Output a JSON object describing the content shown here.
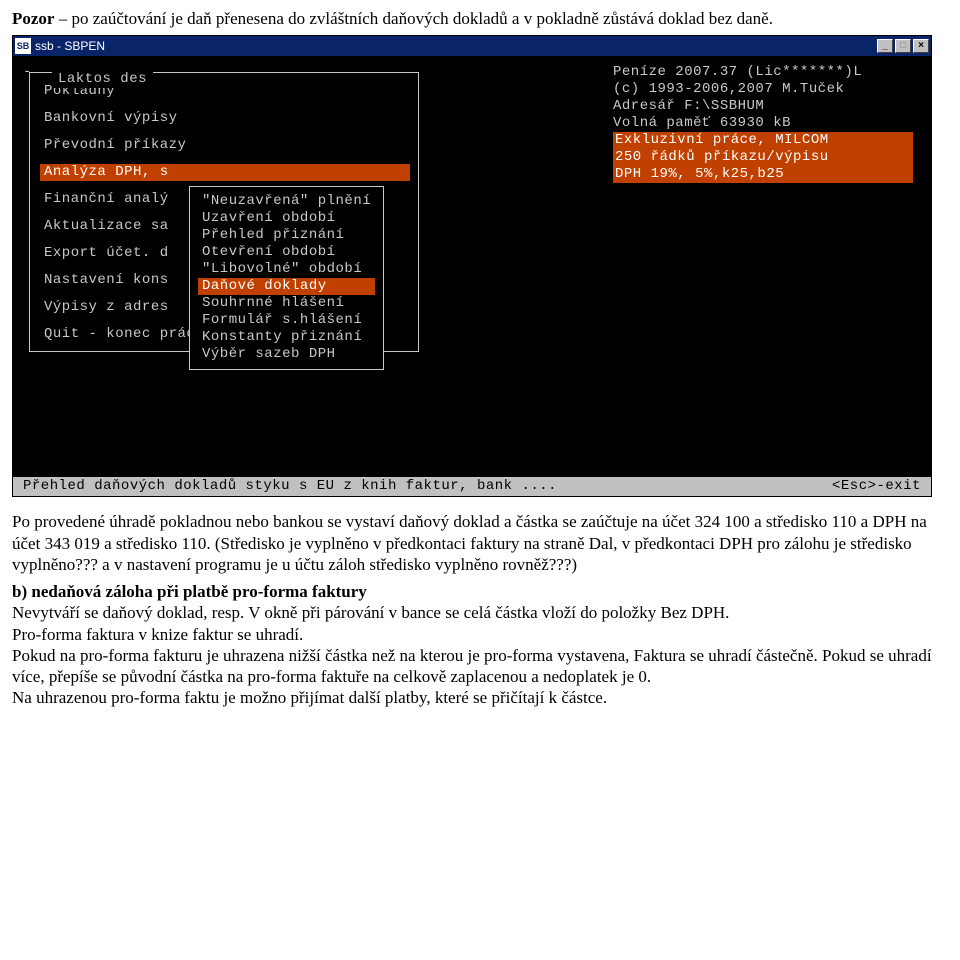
{
  "doc": {
    "top_note_label": "Pozor",
    "top_note_rest": " – po zaúčtování je daň přenesena do zvláštních daňových dokladů a v pokladně zůstává doklad bez daně.",
    "p2": "Po provedené úhradě pokladnou nebo bankou se vystaví daňový doklad a částka se zaúčtuje na účet  324 100 a středisko 110 a DPH na účet 343 019 a středisko 110. (Středisko je vyplněno v předkontaci faktury na straně Dal,  v předkontaci DPH pro zálohu je středisko vyplněno??? a v nastavení programu je u účtu záloh středisko vyplněno rovněž???)",
    "b_heading": "b) nedaňová záloha při platbě pro-forma faktury",
    "p3": "Nevytváří se daňový doklad, resp. V okně při párování v bance se celá částka vloží do položky Bez DPH.",
    "p4": "Pro-forma faktura v knize faktur se uhradí.",
    "p5": "Pokud na pro-forma fakturu je uhrazena nižší částka než na kterou je pro-forma vystavena, Faktura se uhradí částečně. Pokud se uhradí více, přepíše se původní částka na pro-forma faktuře na celkově zaplacenou a nedoplatek je 0.",
    "p6": "Na uhrazenou pro-forma faktu je možno přijímat další platby, které se přičítají k částce."
  },
  "window": {
    "icon_text": "SB",
    "title": "ssb - SBPEN",
    "btn_min": "_",
    "btn_max": "□",
    "btn_close": "×"
  },
  "dos": {
    "caret": "-",
    "menu_legend": "Laktos des",
    "main_menu": [
      "Pokladny",
      "",
      "Bankovní výpisy",
      "",
      "Převodní příkazy",
      "",
      "Analýza DPH, s",
      "",
      "Finanční analý",
      "",
      "Aktualizace sa",
      "",
      "Export účet. d",
      "",
      "Nastavení kons",
      "",
      "Výpisy z adres",
      "",
      "Quit - konec práce"
    ],
    "main_menu_selected_index": 6,
    "submenu": [
      "\"Neuzavřená\" plnění",
      "Uzavření období",
      "Přehled přiznání",
      "Otevření období",
      "\"Libovolné\" období",
      "Daňové doklady",
      "Souhrnné hlášení",
      "Formulář s.hlášení",
      "Konstanty přiznání",
      "Výběr sazeb DPH"
    ],
    "submenu_selected_index": 5,
    "info_plain": [
      "Peníze 2007.37 (Lic*******)L",
      "(c) 1993-2006,2007 M.Tuček",
      "Adresář F:\\SSBHUM",
      "Volná paměť 63930 kB"
    ],
    "info_hl": [
      "Exkluzivní práce, MILCOM",
      "250 řádků příkazu/výpisu",
      "DPH 19%, 5%,k25,b25"
    ],
    "status_left": "Přehled daňových dokladů styku s EU z knih faktur, bank ....",
    "status_right": "<Esc>-exit"
  }
}
